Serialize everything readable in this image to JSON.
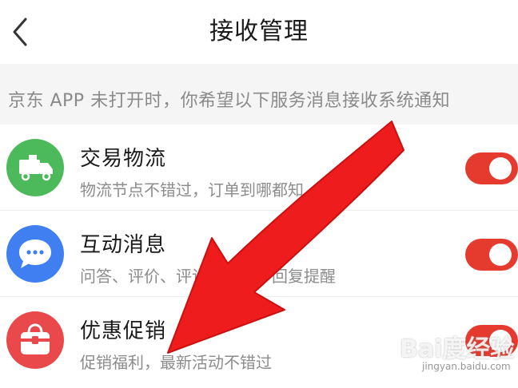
{
  "header": {
    "title": "接收管理",
    "back_icon": "chevron-left-icon"
  },
  "notice": {
    "text": "京东 APP 未打开时，你希望以下服务消息接收系统通知"
  },
  "items": [
    {
      "title": "交易物流",
      "subtitle": "物流节点不错过，订单到哪都知",
      "icon": "delivery-truck-icon",
      "icon_color": "#4cba5a",
      "enabled": true
    },
    {
      "title": "互动消息",
      "subtitle": "问答、评价、评论、点赞、回复提醒",
      "icon": "chat-bubble-icon",
      "icon_color": "#3f7ff2",
      "enabled": true
    },
    {
      "title": "优惠促销",
      "subtitle": "促销福利，最新活动不错过",
      "icon": "gift-bag-icon",
      "icon_color": "#e9494a",
      "enabled": true
    }
  ],
  "colors": {
    "toggle_on": "#e53a2e",
    "arrow": "#ee1c1c",
    "notice_bg": "#f5f5f5"
  },
  "watermark": {
    "main": "Bai度经验",
    "sub": "jingyan.baidu.com"
  }
}
